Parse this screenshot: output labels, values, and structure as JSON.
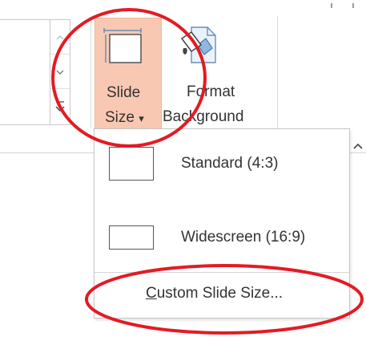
{
  "ribbon": {
    "slide_size": {
      "label_line1": "Slide",
      "label_line2": "Size",
      "dropdown_arrow": "▾",
      "icon": "slide-size-icon"
    },
    "format_background": {
      "label_line1": "Format",
      "label_line2": "Background",
      "icon": "format-background-icon"
    },
    "collapse_icon": "chevron-up-icon"
  },
  "menu": {
    "items": [
      {
        "label": "Standard (4:3)",
        "icon": "standard-thumbnail-icon"
      },
      {
        "label": "Widescreen (16:9)",
        "icon": "widescreen-thumbnail-icon"
      }
    ],
    "custom": {
      "accelerator": "C",
      "rest": "ustom Slide Size..."
    }
  },
  "annotations": {
    "color": "#e31b23"
  },
  "colors": {
    "highlight": "#f9c8b2",
    "text": "#333333"
  }
}
